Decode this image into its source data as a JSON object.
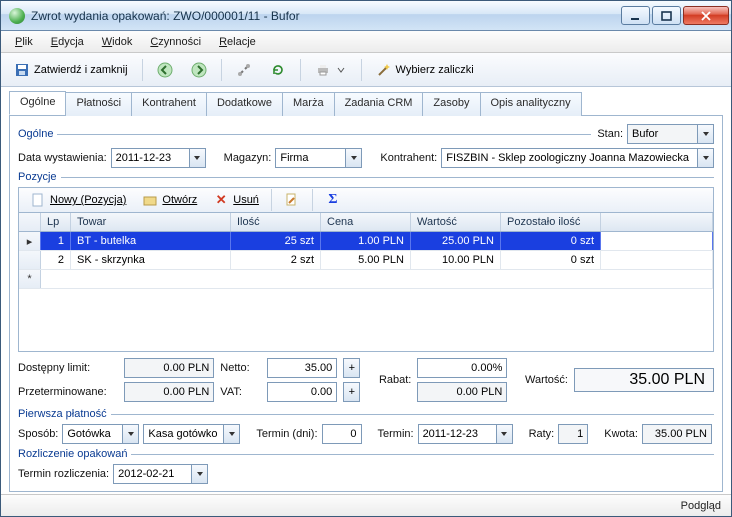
{
  "window": {
    "title": "Zwrot wydania opakowań: ZWO/000001/11 - Bufor"
  },
  "menu": {
    "items": [
      "Plik",
      "Edycja",
      "Widok",
      "Czynności",
      "Relacje"
    ]
  },
  "toolbar": {
    "confirm_close": "Zatwierdź i zamknij",
    "select_advances": "Wybierz zaliczki"
  },
  "tabs": [
    "Ogólne",
    "Płatności",
    "Kontrahent",
    "Dodatkowe",
    "Marża",
    "Zadania CRM",
    "Zasoby",
    "Opis analityczny"
  ],
  "general": {
    "group_label": "Ogólne",
    "stan_label": "Stan:",
    "stan_value": "Bufor",
    "date_label": "Data wystawienia:",
    "date_value": "2011-12-23",
    "magazyn_label": "Magazyn:",
    "magazyn_value": "Firma",
    "kontrahent_label": "Kontrahent:",
    "kontrahent_value": "FISZBIN - Sklep zoologiczny Joanna Mazowiecka"
  },
  "positions": {
    "group_label": "Pozycje",
    "btn_new": "Nowy (Pozycja)",
    "btn_open": "Otwórz",
    "btn_delete": "Usuń",
    "headers": {
      "lp": "Lp",
      "towar": "Towar",
      "ilosc": "Ilość",
      "cena": "Cena",
      "wartosc": "Wartość",
      "pozostalo": "Pozostało ilość"
    },
    "rows": [
      {
        "lp": "1",
        "towar": "BT - butelka",
        "ilosc": "25 szt",
        "cena": "1.00 PLN",
        "wartosc": "25.00 PLN",
        "pozostalo": "0 szt",
        "selected": true
      },
      {
        "lp": "2",
        "towar": "SK - skrzynka",
        "ilosc": "2 szt",
        "cena": "5.00 PLN",
        "wartosc": "10.00 PLN",
        "pozostalo": "0 szt",
        "selected": false
      }
    ]
  },
  "summary": {
    "limit_label": "Dostępny limit:",
    "limit_value": "0.00 PLN",
    "overdue_label": "Przeterminowane:",
    "overdue_value": "0.00 PLN",
    "netto_label": "Netto:",
    "netto_value": "35.00",
    "vat_label": "VAT:",
    "vat_value": "0.00",
    "rabat_label": "Rabat:",
    "rabat_pct": "0.00%",
    "rabat_val": "0.00 PLN",
    "wartosc_label": "Wartość:",
    "wartosc_value": "35.00 PLN"
  },
  "payment": {
    "group_label": "Pierwsza płatność",
    "sposob_label": "Sposób:",
    "sposob_value": "Gotówka",
    "kasa_value": "Kasa gotówko",
    "termin_dni_label": "Termin (dni):",
    "termin_dni_value": "0",
    "termin_label": "Termin:",
    "termin_value": "2011-12-23",
    "raty_label": "Raty:",
    "raty_value": "1",
    "kwota_label": "Kwota:",
    "kwota_value": "35.00 PLN"
  },
  "settlement": {
    "group_label": "Rozliczenie opakowań",
    "termin_label": "Termin rozliczenia:",
    "termin_value": "2012-02-21"
  },
  "footer": {
    "preview": "Podgląd"
  }
}
